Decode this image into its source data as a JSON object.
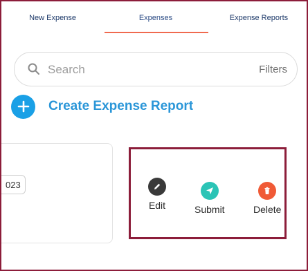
{
  "tabs": [
    {
      "label": "New Expense",
      "active": false
    },
    {
      "label": "Expenses",
      "active": true
    },
    {
      "label": "Expense Reports",
      "active": false
    }
  ],
  "search": {
    "placeholder": "Search",
    "filters_label": "Filters"
  },
  "create_report": {
    "label": "Create Expense Report"
  },
  "card": {
    "date_fragment": "023"
  },
  "actions": {
    "edit": {
      "label": "Edit",
      "color": "#3a3a3a"
    },
    "submit": {
      "label": "Submit",
      "color": "#2bc4b6"
    },
    "delete": {
      "label": "Delete",
      "color": "#f05a36"
    }
  },
  "colors": {
    "frame": "#8c1d3a",
    "tab_underline": "#f06a4f",
    "create_accent": "#1aa0e6"
  }
}
